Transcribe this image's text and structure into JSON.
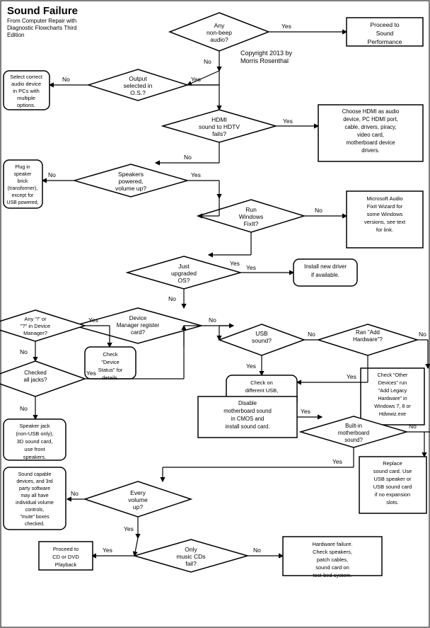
{
  "title": "Sound Failure",
  "subtitle": "From Computer Repair with Diagnostic Flowcharts Third Edition",
  "copyright": "Copyright 2013 by Morris Rosenthal",
  "nodes": {
    "any_non_beep_audio": "Any non-beep audio?",
    "proceed_to_sound_performance": "Proceed to Sound Performance",
    "output_selected_in_os": "Output selected in O.S.?",
    "select_correct_audio_device": "Select correct audio device in PCs with multiple options.",
    "hdmi_sound_fails": "HDMI sound to HDTV fails?",
    "choose_hdmi": "Choose HDMI as audio device, PC HDMI port, cable, drivers, piracy, video card, motherboard device drivers.",
    "speakers_powered": "Speakers powered, volume up?",
    "plug_in_speaker_brick": "Plug in speaker brick (transformer), except for USB powered, turn up external volume.",
    "run_windows_fixit": "Run Windows FixIt?",
    "microsoft_audio": "Microsoft Audio FixIt Wizard for some Windows versions, see text for link.",
    "just_upgraded_os": "Just upgraded OS?",
    "install_new_driver": "Install new driver if available.",
    "device_manager_register": "Device Manager register card?",
    "any_i_or_q": "Any \"!\" or \"?\" in Device Manager?",
    "check_device_status": "Check \"Device Status\" for details.",
    "checked_all_jacks": "Checked all jacks?",
    "speaker_jack": "Speaker jack (non-USB only), 3D sound card, use front speakers.",
    "usb_sound": "USB sound?",
    "check_different_usb": "Check on different USB, cable, PC.",
    "ran_add_hardware": "Ran \"Add Hardware\"?",
    "check_other_devices": "Check \"Other Devices\" run \"Add Legacy Hardware\" in Windows 7, 8 or Hdwwiz.exe",
    "disable_motherboard": "Disable motherboard sound in CMOS and install sound card.",
    "builtin_motherboard_sound": "Built-in motherboard sound?",
    "replace_sound_card": "Replace sound card. Use USB speaker or USB sound card if no expansion slots.",
    "every_volume_up": "Every volume up?",
    "sound_capable_devices": "Sound capable devices, and 3rd party software may all have individual volume controls, \"mute\" boxes checked.",
    "only_music_cds_fail": "Only music CDs fail?",
    "proceed_to_cd_dvd": "Proceed to CD or DVD Playback",
    "hardware_failure": "Hardware failure. Check speakers, patch cables, sound card on test-bed system."
  }
}
